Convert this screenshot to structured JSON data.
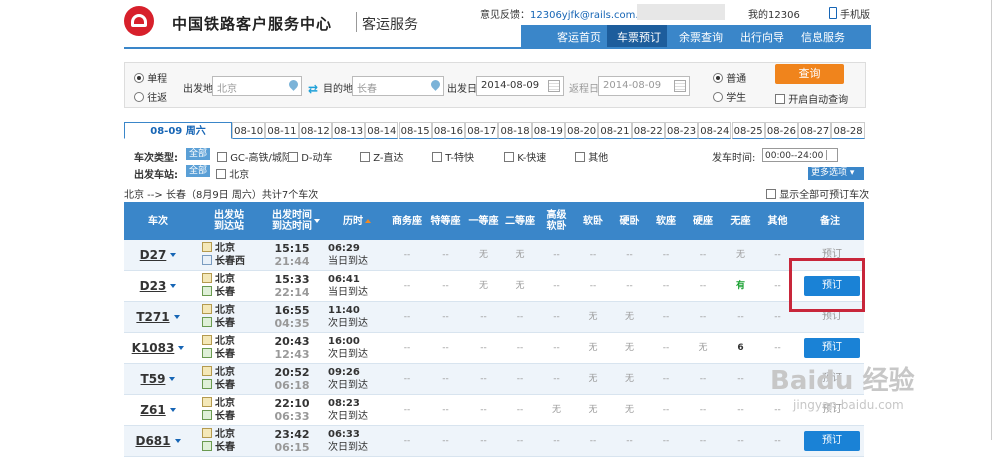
{
  "header": {
    "brand": "中国铁路客户服务中心",
    "subtitle": "客运服务",
    "feedback_label": "意见反馈：",
    "feedback_email": "12306yjfk@rails.com.cn",
    "my_account": "我的12306",
    "mobile": "手机版"
  },
  "nav": [
    "客运首页",
    "车票预订",
    "余票查询",
    "出行向导",
    "信息服务"
  ],
  "nav_active": "车票预订",
  "search": {
    "one_way": "单程",
    "round_trip": "往返",
    "from_label": "出发地",
    "from_value": "北京",
    "to_label": "目的地",
    "to_value": "长春",
    "depart_label": "出发日",
    "depart_value": "2014-08-09",
    "return_label": "返程日",
    "return_value": "2014-08-09",
    "normal": "普通",
    "student": "学生",
    "query_button": "查询",
    "auto_query": "开启自动查询"
  },
  "dates": [
    "08-09 周六",
    "08-10",
    "08-11",
    "08-12",
    "08-13",
    "08-14",
    "08-15",
    "08-16",
    "08-17",
    "08-18",
    "08-19",
    "08-20",
    "08-21",
    "08-22",
    "08-23",
    "08-24",
    "08-25",
    "08-26",
    "08-27",
    "08-28"
  ],
  "filters": {
    "type_label": "车次类型:",
    "all": "全部",
    "types": [
      "GC-高铁/城际",
      "D-动车",
      "Z-直达",
      "T-特快",
      "K-快速",
      "其他"
    ],
    "station_label": "出发车站:",
    "stations": [
      "北京"
    ],
    "time_label": "发车时间:",
    "time_value": "00:00--24:00",
    "more_options": "更多选项"
  },
  "summary": "北京 --> 长春（8月9日 周六）共计7个车次",
  "show_all_bookable": "显示全部可预订车次",
  "table_headers": [
    "车次",
    "出发站\n到达站",
    "出发时间\n到达时间",
    "历时",
    "商务座",
    "特等座",
    "一等座",
    "二等座",
    "高级\n软卧",
    "软卧",
    "硬卧",
    "软座",
    "硬座",
    "无座",
    "其他",
    "备注"
  ],
  "rows": [
    {
      "train": "D27",
      "from": "北京",
      "to": "长春西",
      "dep": "15:15",
      "arr": "21:44",
      "dur": "06:29",
      "note": "当日到达",
      "seats": [
        "--",
        "--",
        "无",
        "无",
        "--",
        "--",
        "--",
        "--",
        "--",
        "无",
        "--"
      ],
      "book": "预订",
      "bookable": false
    },
    {
      "train": "D23",
      "from": "北京",
      "to": "长春",
      "dep": "15:33",
      "arr": "22:14",
      "dur": "06:41",
      "note": "当日到达",
      "seats": [
        "--",
        "--",
        "无",
        "无",
        "--",
        "--",
        "--",
        "--",
        "--",
        "有",
        "--"
      ],
      "book": "预订",
      "bookable": true
    },
    {
      "train": "T271",
      "from": "北京",
      "to": "长春",
      "dep": "16:55",
      "arr": "04:35",
      "dur": "11:40",
      "note": "次日到达",
      "seats": [
        "--",
        "--",
        "--",
        "--",
        "--",
        "无",
        "无",
        "--",
        "--",
        "--",
        "--"
      ],
      "book": "预订",
      "bookable": false
    },
    {
      "train": "K1083",
      "from": "北京",
      "to": "长春",
      "dep": "20:43",
      "arr": "12:43",
      "dur": "16:00",
      "note": "次日到达",
      "seats": [
        "--",
        "--",
        "--",
        "--",
        "--",
        "无",
        "无",
        "--",
        "无",
        "6",
        "--"
      ],
      "book": "预订",
      "bookable": true
    },
    {
      "train": "T59",
      "from": "北京",
      "to": "长春",
      "dep": "20:52",
      "arr": "06:18",
      "dur": "09:26",
      "note": "次日到达",
      "seats": [
        "--",
        "--",
        "--",
        "--",
        "--",
        "无",
        "无",
        "--",
        "--",
        "--",
        "--"
      ],
      "book": "预订",
      "bookable": false
    },
    {
      "train": "Z61",
      "from": "北京",
      "to": "长春",
      "dep": "22:10",
      "arr": "06:33",
      "dur": "08:23",
      "note": "次日到达",
      "seats": [
        "--",
        "--",
        "--",
        "--",
        "无",
        "无",
        "无",
        "--",
        "--",
        "--",
        "--"
      ],
      "book": "预订",
      "bookable": false
    },
    {
      "train": "D681",
      "from": "北京",
      "to": "长春",
      "dep": "23:42",
      "arr": "06:15",
      "dur": "06:33",
      "note": "次日到达",
      "seats": [
        "--",
        "--",
        "--",
        "--",
        "--",
        "--",
        "--",
        "--",
        "--",
        "--",
        "--"
      ],
      "book": "预订",
      "bookable": true
    }
  ],
  "watermark": "Baidu 经验",
  "watermark_url": "jingyan.baidu.com",
  "colors": {
    "brand_red": "#d7202b",
    "nav_blue": "#3a86c9",
    "book_blue": "#1a82d6",
    "query_orange": "#f0841c",
    "highlight_red": "#c8263a"
  }
}
